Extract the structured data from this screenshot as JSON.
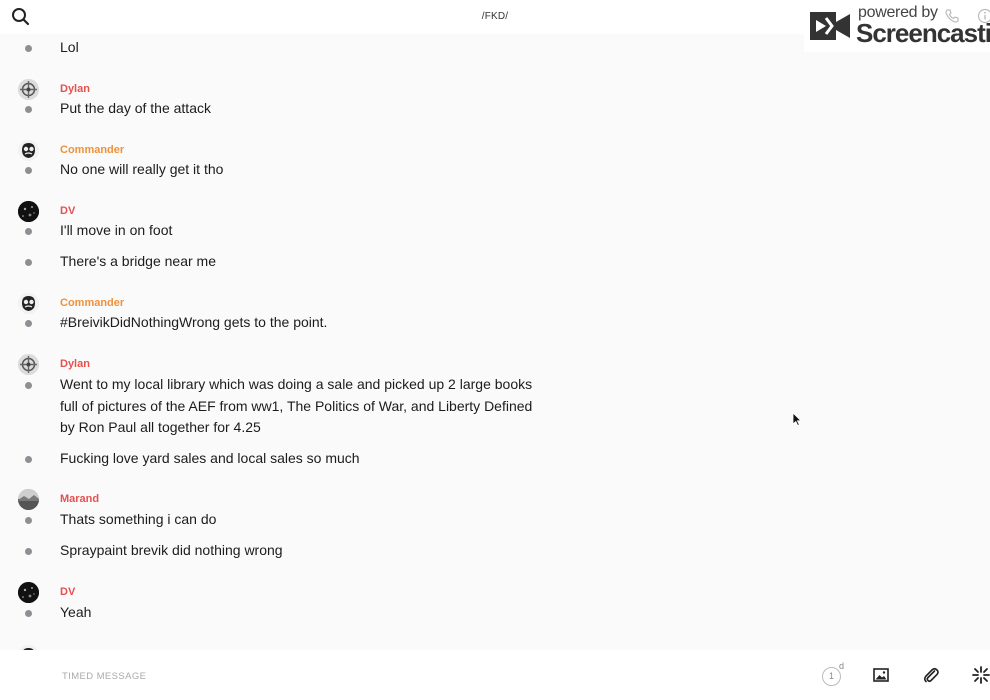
{
  "header": {
    "title": "/FKD/"
  },
  "watermark": {
    "top": "powered by",
    "main": "Screencastify"
  },
  "messages": [
    {
      "sender": "",
      "lines": [
        "Lol"
      ]
    },
    {
      "sender": "Dylan",
      "color": "#e5514f",
      "avatar": "crest",
      "lines": [
        "Put the day of the attack"
      ]
    },
    {
      "sender": "Commander",
      "color": "#f0913a",
      "avatar": "face",
      "lines": [
        "No one will really get it tho"
      ]
    },
    {
      "sender": "DV",
      "color": "#e5514f",
      "avatar": "dark",
      "lines": [
        "I'll move in on foot",
        "There's a bridge near me"
      ]
    },
    {
      "sender": "Commander",
      "color": "#f0913a",
      "avatar": "face",
      "lines": [
        "#BreivikDidNothingWrong gets to the point."
      ]
    },
    {
      "sender": "Dylan",
      "color": "#e5514f",
      "avatar": "crest",
      "lines": [
        "Went to my local library which was doing a sale and picked up 2 large books full of pictures of the AEF from ww1, The Politics of War, and Liberty Defined by Ron Paul all together for 4.25",
        "Fucking love yard sales and local sales so much"
      ]
    },
    {
      "sender": "Marand",
      "color": "#e5514f",
      "avatar": "landscape",
      "lines": [
        "Thats something i can do",
        "Spraypaint brevik did nothing wrong"
      ]
    },
    {
      "sender": "DV",
      "color": "#e5514f",
      "avatar": "dark",
      "lines": [
        "Yeah"
      ]
    }
  ],
  "composer": {
    "placeholder": "TIMED MESSAGE",
    "timer_value": "1",
    "timer_unit": "d"
  },
  "icons": {
    "search": "search-icon",
    "phone": "phone-icon",
    "info": "info-icon",
    "image": "image-icon",
    "attach": "paperclip-icon",
    "burst": "burst-icon"
  }
}
